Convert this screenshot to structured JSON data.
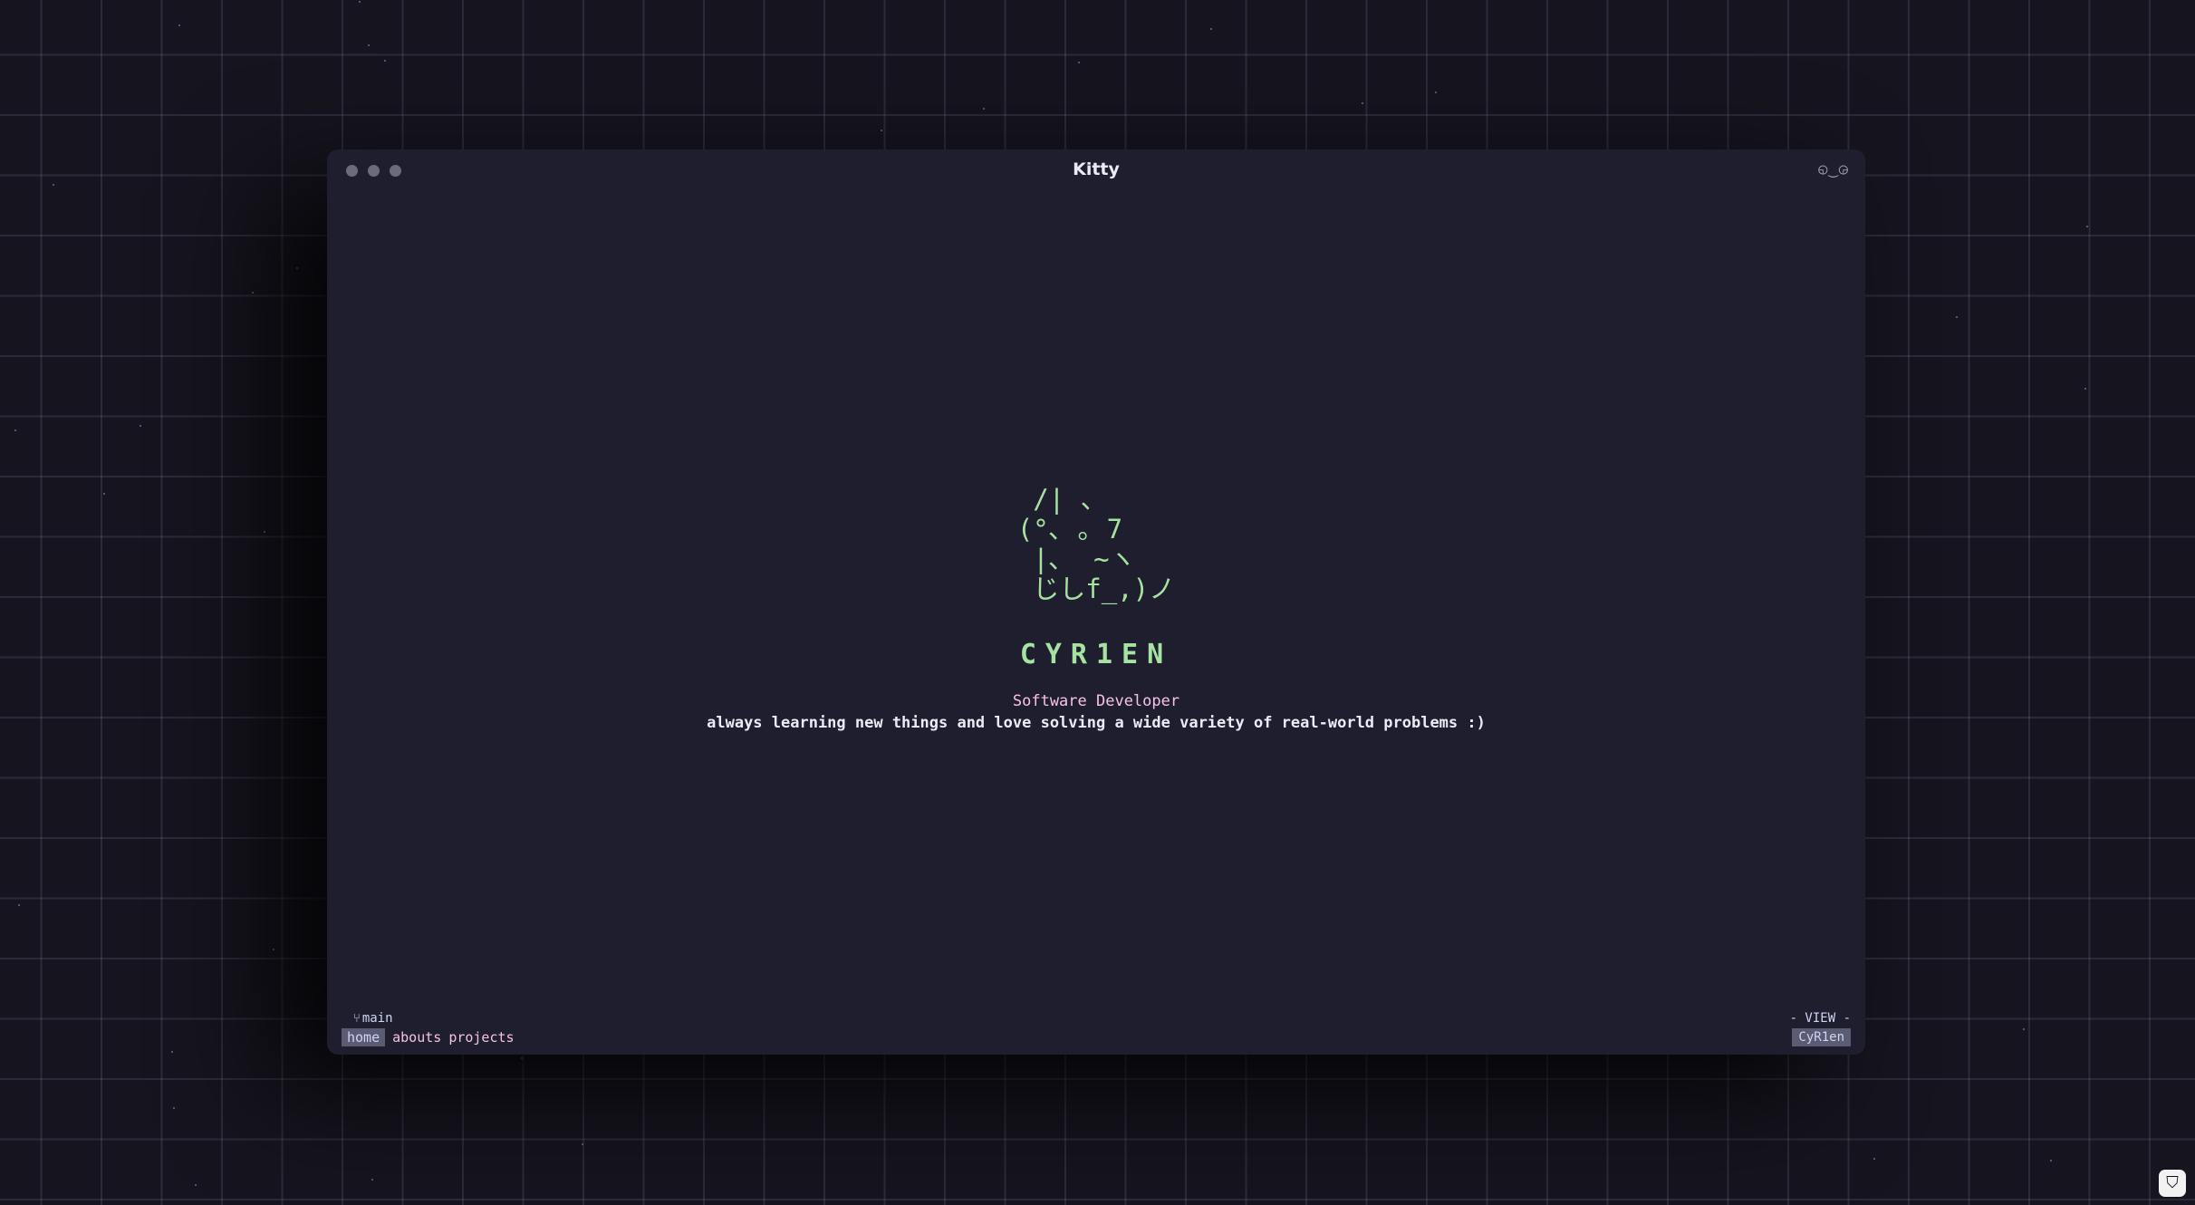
{
  "window": {
    "title": "Kitty",
    "face": "◵‿◶"
  },
  "hero": {
    "ascii_art": " /| 、\n(°､ ｡ 7\n |､  ~ヽ\n じしf_,)ノ",
    "name": "CYR1EN",
    "role": "Software Developer",
    "tagline": "always learning new things and love solving a wide variety of real-world problems :)"
  },
  "statusbar": {
    "branch_icon": "git-branch-icon",
    "branch": "main",
    "tabs": [
      {
        "label": "home",
        "active": true
      },
      {
        "label": "abouts",
        "active": false
      },
      {
        "label": "projects",
        "active": false
      }
    ],
    "mode": "- VIEW -",
    "user": "CyR1en"
  },
  "colors": {
    "accent_green": "#a6e3a1",
    "accent_pink": "#f5c2e7",
    "window_bg": "#1f1e2e"
  }
}
